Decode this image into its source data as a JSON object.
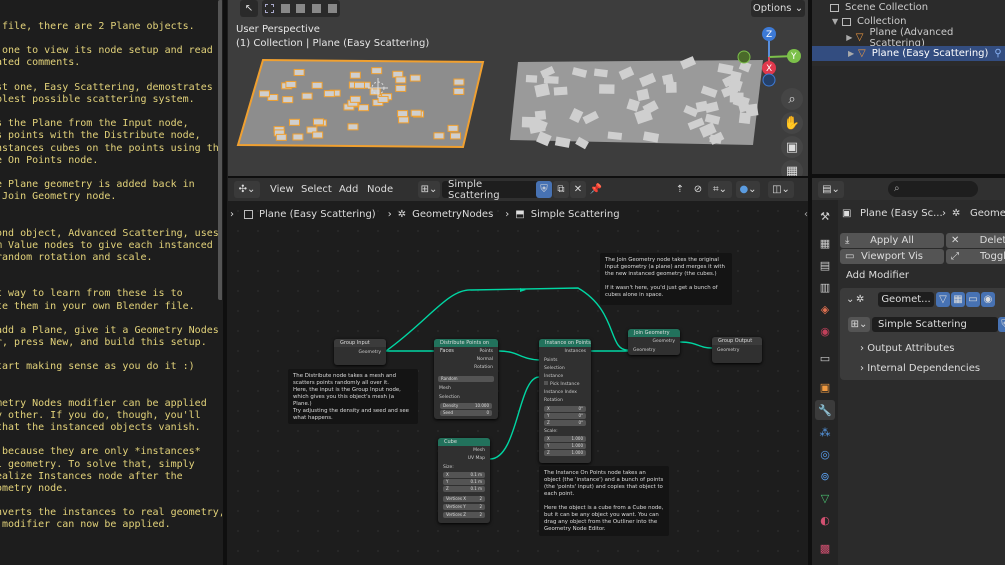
{
  "text_editor": {
    "lines": [
      " file, there are 2 Plane objects.",
      "",
      " one to view its node setup and read",
      "ated comments.",
      "",
      "st one, Easy Scattering, demostrates",
      "plest possible scattering system.",
      "",
      "s the Plane from the Input node,",
      "s points with the Distribute node,",
      "nstances cubes on the points using the",
      "e On Points node.",
      "",
      "e Plane geometry is added back in",
      " Join Geometry node.",
      "",
      "",
      "ond object, Advanced Scattering, uses",
      "m Value nodes to give each instanced",
      "random rotation and scale.",
      "",
      "",
      "t way to learn from these is to",
      "te them in your own Blender file.",
      "",
      "add a Plane, give it a Geometry Nodes",
      "r, press New, and build this setup.",
      "",
      "tart making sense as you do it :)",
      "",
      "",
      "metry Nodes modifier can be applied",
      "y other. If you do, though, you'll",
      "that the instanced objects vanish.",
      "",
      " because they are only *instances*",
      "l geometry. To solve that, simply",
      "ealize Instances node after the",
      "ometry node.",
      "",
      "nverts the instances to real geometry,",
      " modifier can now be applied."
    ]
  },
  "viewport": {
    "options_label": "Options",
    "perspective_label": "User Perspective",
    "context_label": "(1) Collection | Plane (Easy Scattering)",
    "axis_labels": {
      "z": "Z",
      "y": "Y",
      "x": "X"
    }
  },
  "outliner": {
    "scene_collection": "Scene Collection",
    "collection": "Collection",
    "items": [
      "Plane (Advanced Scattering)",
      "Plane (Easy Scattering)"
    ]
  },
  "node_header": {
    "menus": [
      "View",
      "Select",
      "Add",
      "Node"
    ],
    "tree_name": "Simple Scattering"
  },
  "breadcrumb": {
    "object": "Plane (Easy Scattering)",
    "modifier": "GeometryNodes",
    "tree": "Simple Scattering"
  },
  "nodes": {
    "group_input": {
      "title": "Group Input",
      "out": "Geometry"
    },
    "distribute": {
      "title": "Distribute Points on Faces",
      "outs": [
        "Points",
        "Normal",
        "Rotation"
      ],
      "mode": "Random",
      "ins": [
        "Mesh",
        "Selection"
      ],
      "density_label": "Density",
      "density": "10.000",
      "seed_label": "Seed",
      "seed": "0"
    },
    "instance": {
      "title": "Instance on Points",
      "out": "Instances",
      "ins": [
        "Points",
        "Selection",
        "Instance",
        "Pick Instance",
        "Instance Index",
        "Rotation"
      ],
      "rot": [
        [
          "X",
          "0°"
        ],
        [
          "Y",
          "0°"
        ],
        [
          "Z",
          "0°"
        ]
      ],
      "scale_label": "Scale:",
      "scale": [
        [
          "X",
          "1.000"
        ],
        [
          "Y",
          "1.000"
        ],
        [
          "Z",
          "1.000"
        ]
      ]
    },
    "join": {
      "title": "Join Geometry",
      "out": "Geometry",
      "in": "Geometry"
    },
    "group_output": {
      "title": "Group Output",
      "in": "Geometry"
    },
    "cube": {
      "title": "Cube",
      "outs": [
        "Mesh",
        "UV Map"
      ],
      "size_label": "Size:",
      "size": [
        [
          "X",
          "0.1 m"
        ],
        [
          "Y",
          "0.1 m"
        ],
        [
          "Z",
          "0.1 m"
        ]
      ],
      "verts": [
        [
          "Vertices X",
          "2"
        ],
        [
          "Vertices Y",
          "2"
        ],
        [
          "Vertices Z",
          "2"
        ]
      ]
    }
  },
  "frames": {
    "distribute_note": "The Distribute node takes a mesh and scatters points randomly all over it.\nHere, the input is the Group Input node, which gives you this object's mesh (a Plane.)\nTry adjusting the density and seed and see what happens.",
    "join_note": "The Join Geometry node takes the original input geometry (a plane) and merges it with the new instanced geometry (the cubes.)\n\nIf it wasn't here, you'd just get a bunch of cubes alone in space.",
    "instance_note": "The Instance On Points node takes an object (the 'instance') and a bunch of points (the 'points' input) and copies that object to each point.\n\nHere the object is a cube from a Cube node, but it can be any object you want. You can drag any object from the Outliner into the Geometry Node Editor."
  },
  "properties": {
    "object_name": "Plane (Easy Sc...",
    "modifier_tab": "Geomet",
    "apply_all": "Apply All",
    "delete": "Delet",
    "viewport_vis": "Viewport Vis",
    "toggle": "Toggl",
    "add_modifier": "Add Modifier",
    "modifier_name": "Geomet...",
    "tree_name": "Simple Scattering",
    "output_attributes": "Output Attributes",
    "internal_dependencies": "Internal Dependencies"
  },
  "colors": {
    "accent": "#4772b3",
    "selection_orange": "#f0a030",
    "socket_geometry": "#00d6a3",
    "text_yellow": "#e2d27a"
  }
}
